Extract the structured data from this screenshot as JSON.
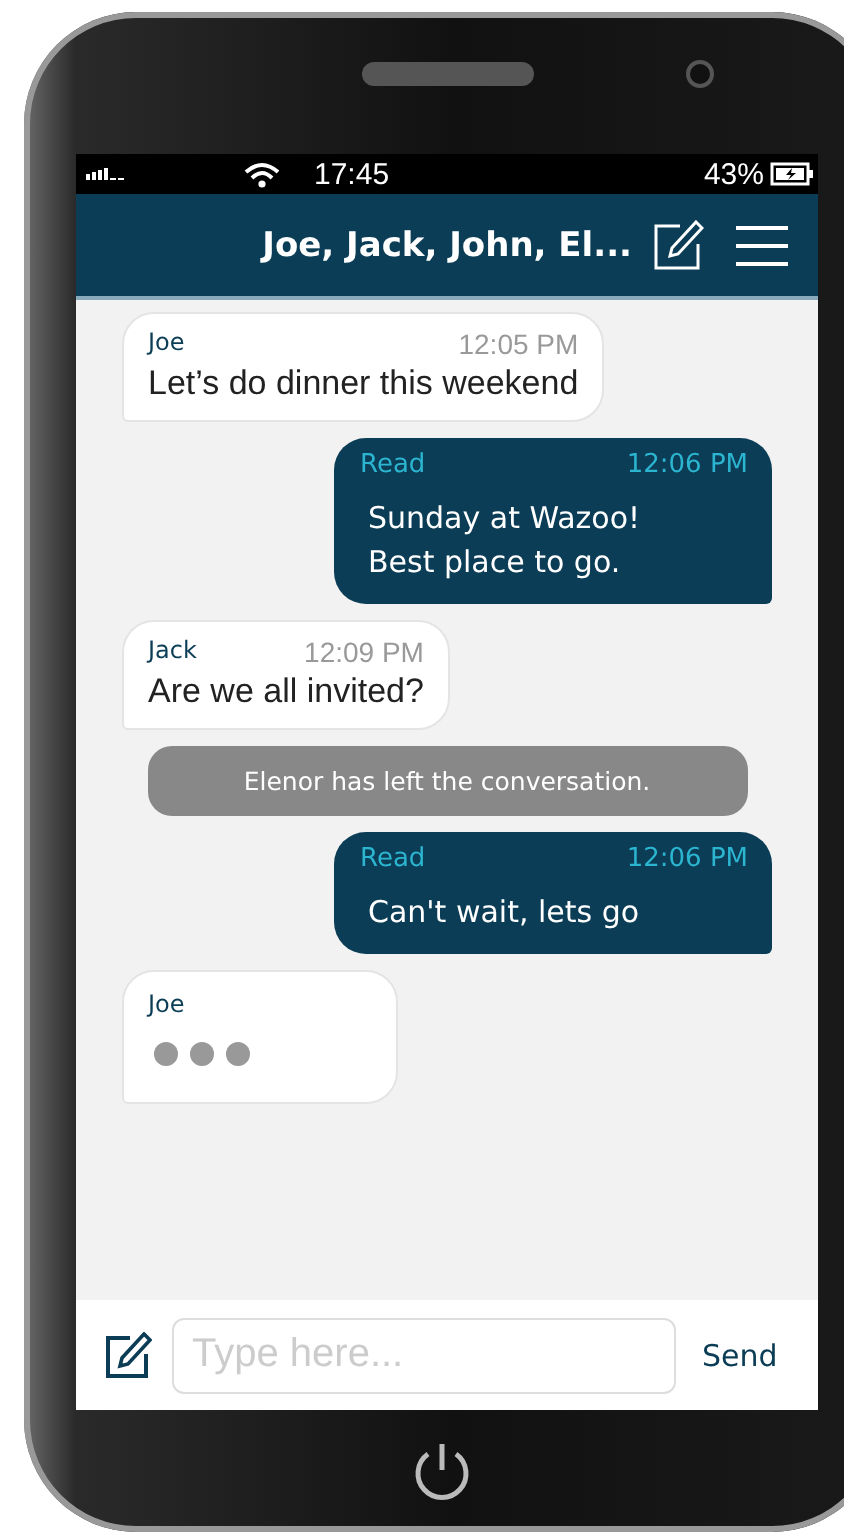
{
  "status_bar": {
    "time": "17:45",
    "battery": "43%"
  },
  "header": {
    "title": "Joe, Jack, John, El..."
  },
  "messages": [
    {
      "kind": "incoming",
      "sender": "Joe",
      "time": "12:05 PM",
      "text": "Let’s do dinner this weekend"
    },
    {
      "kind": "outgoing",
      "status": "Read",
      "time": "12:06 PM",
      "text": "Sunday at Wazoo!\nBest place to go."
    },
    {
      "kind": "incoming",
      "sender": "Jack",
      "time": "12:09 PM",
      "text": "Are we all invited?"
    },
    {
      "kind": "system",
      "text": "Elenor has left the conversation."
    },
    {
      "kind": "outgoing",
      "status": "Read",
      "time": "12:06 PM",
      "text": "Can't wait, lets go"
    },
    {
      "kind": "typing",
      "sender": "Joe"
    }
  ],
  "composer": {
    "placeholder": "Type here...",
    "send": "Send"
  }
}
